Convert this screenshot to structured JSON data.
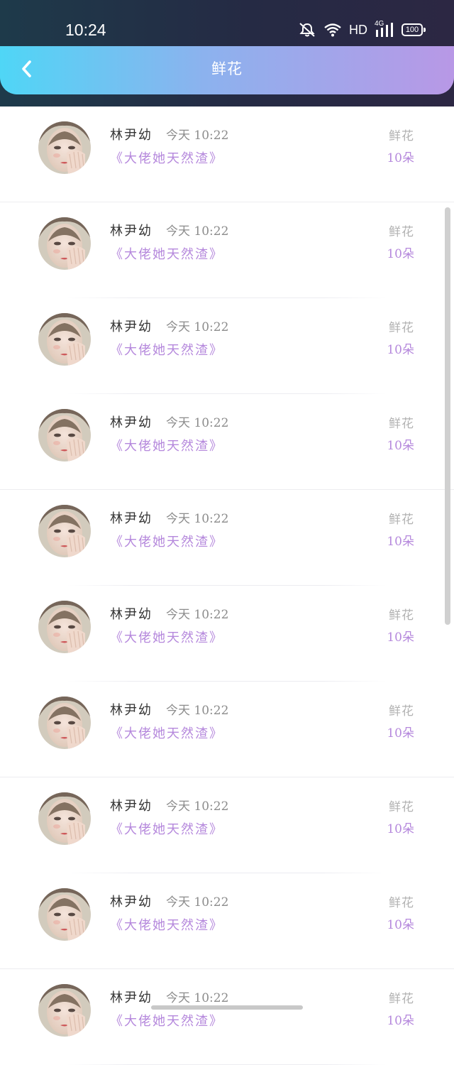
{
  "status_bar": {
    "time": "10:24",
    "network_label": "HD",
    "network_type": "4G",
    "battery": "100",
    "icons": [
      "mute-bell-icon",
      "wifi-icon",
      "signal-icon",
      "battery-icon"
    ]
  },
  "header": {
    "title": "鲜花",
    "back_icon": "chevron-left-icon"
  },
  "colors": {
    "header_gradient_start": "#4fd6f6",
    "header_gradient_end": "#b898e6",
    "accent_purple": "#b588dc",
    "status_bar_bg": "#252a44"
  },
  "items": [
    {
      "name": "林尹幼",
      "time": "今天 10:22",
      "book": "《大佬她天然渣》",
      "gift_type": "鲜花",
      "gift_count": "10朵"
    },
    {
      "name": "林尹幼",
      "time": "今天 10:22",
      "book": "《大佬她天然渣》",
      "gift_type": "鲜花",
      "gift_count": "10朵"
    },
    {
      "name": "林尹幼",
      "time": "今天 10:22",
      "book": "《大佬她天然渣》",
      "gift_type": "鲜花",
      "gift_count": "10朵"
    },
    {
      "name": "林尹幼",
      "time": "今天 10:22",
      "book": "《大佬她天然渣》",
      "gift_type": "鲜花",
      "gift_count": "10朵"
    },
    {
      "name": "林尹幼",
      "time": "今天 10:22",
      "book": "《大佬她天然渣》",
      "gift_type": "鲜花",
      "gift_count": "10朵"
    },
    {
      "name": "林尹幼",
      "time": "今天 10:22",
      "book": "《大佬她天然渣》",
      "gift_type": "鲜花",
      "gift_count": "10朵"
    },
    {
      "name": "林尹幼",
      "time": "今天 10:22",
      "book": "《大佬她天然渣》",
      "gift_type": "鲜花",
      "gift_count": "10朵"
    },
    {
      "name": "林尹幼",
      "time": "今天 10:22",
      "book": "《大佬她天然渣》",
      "gift_type": "鲜花",
      "gift_count": "10朵"
    },
    {
      "name": "林尹幼",
      "time": "今天 10:22",
      "book": "《大佬她天然渣》",
      "gift_type": "鲜花",
      "gift_count": "10朵"
    },
    {
      "name": "林尹幼",
      "time": "今天 10:22",
      "book": "《大佬她天然渣》",
      "gift_type": "鲜花",
      "gift_count": "10朵"
    }
  ]
}
